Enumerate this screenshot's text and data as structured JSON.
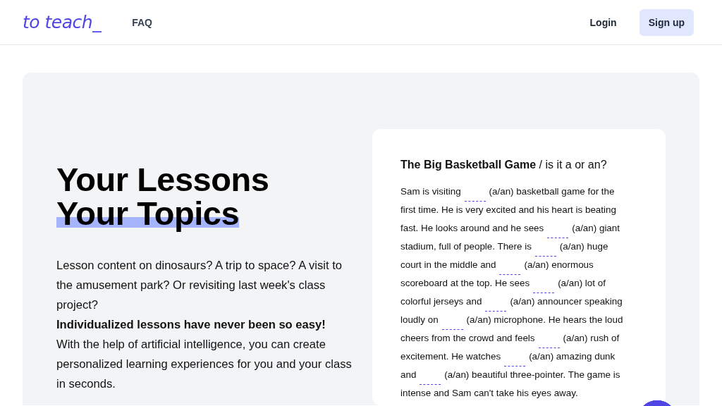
{
  "header": {
    "logo": "to teach_",
    "nav": [
      {
        "label": "FAQ"
      }
    ],
    "login": "Login",
    "signup": "Sign up"
  },
  "hero": {
    "headline": [
      {
        "text": "Your Lessons",
        "highlighted": false
      },
      {
        "text": "Your Topics",
        "highlighted": true
      }
    ],
    "description": [
      {
        "kind": "plain",
        "text": "Lesson content on dinosaurs? A trip to space? A visit to the amusement park? Or revisiting last week's class project?"
      },
      {
        "kind": "strong",
        "text": "Individualized lessons have never been so easy!"
      },
      {
        "kind": "plain",
        "text": "With the help of artificial intelligence, you can create personalized learning experiences for you and your class in seconds."
      }
    ]
  },
  "example": {
    "title": "The Big Basketball Game",
    "subtitle": "/ is it a or an?",
    "lines": [
      [
        {
          "kind": "text",
          "text": "Sam is visiting"
        },
        {
          "kind": "blank"
        },
        {
          "kind": "text",
          "text": "(a/an) basketball game for the"
        }
      ],
      [
        {
          "kind": "text",
          "text": "first time. He is very excited and his heart is beating"
        }
      ],
      [
        {
          "kind": "text",
          "text": "fast. He looks around and he sees"
        },
        {
          "kind": "blank"
        },
        {
          "kind": "text",
          "text": "(a/an) giant"
        }
      ],
      [
        {
          "kind": "text",
          "text": "stadium, full of people. There is"
        },
        {
          "kind": "blank"
        },
        {
          "kind": "text",
          "text": "(a/an) huge"
        }
      ],
      [
        {
          "kind": "text",
          "text": "court in the middle and"
        },
        {
          "kind": "blank"
        },
        {
          "kind": "text",
          "text": "(a/an) enormous"
        }
      ],
      [
        {
          "kind": "text",
          "text": "scoreboard at the top. He sees"
        },
        {
          "kind": "blank"
        },
        {
          "kind": "text",
          "text": "(a/an) lot of"
        }
      ],
      [
        {
          "kind": "text",
          "text": "colorful jerseys and"
        },
        {
          "kind": "blank"
        },
        {
          "kind": "text",
          "text": "(a/an) announcer speaking"
        }
      ],
      [
        {
          "kind": "text",
          "text": "loudly on"
        },
        {
          "kind": "blank"
        },
        {
          "kind": "text",
          "text": "(a/an) microphone. He hears the loud"
        }
      ],
      [
        {
          "kind": "text",
          "text": "cheers from the crowd and feels"
        },
        {
          "kind": "blank"
        },
        {
          "kind": "text",
          "text": "(a/an) rush of"
        }
      ],
      [
        {
          "kind": "text",
          "text": "excitement. He watches"
        },
        {
          "kind": "blank"
        },
        {
          "kind": "text",
          "text": "(a/an) amazing dunk"
        }
      ],
      [
        {
          "kind": "text",
          "text": "and"
        },
        {
          "kind": "blank"
        },
        {
          "kind": "text",
          "text": "(a/an) beautiful three-pointer. The game is"
        }
      ],
      [
        {
          "kind": "text",
          "text": "intense and Sam can't take his eyes away."
        }
      ]
    ]
  }
}
